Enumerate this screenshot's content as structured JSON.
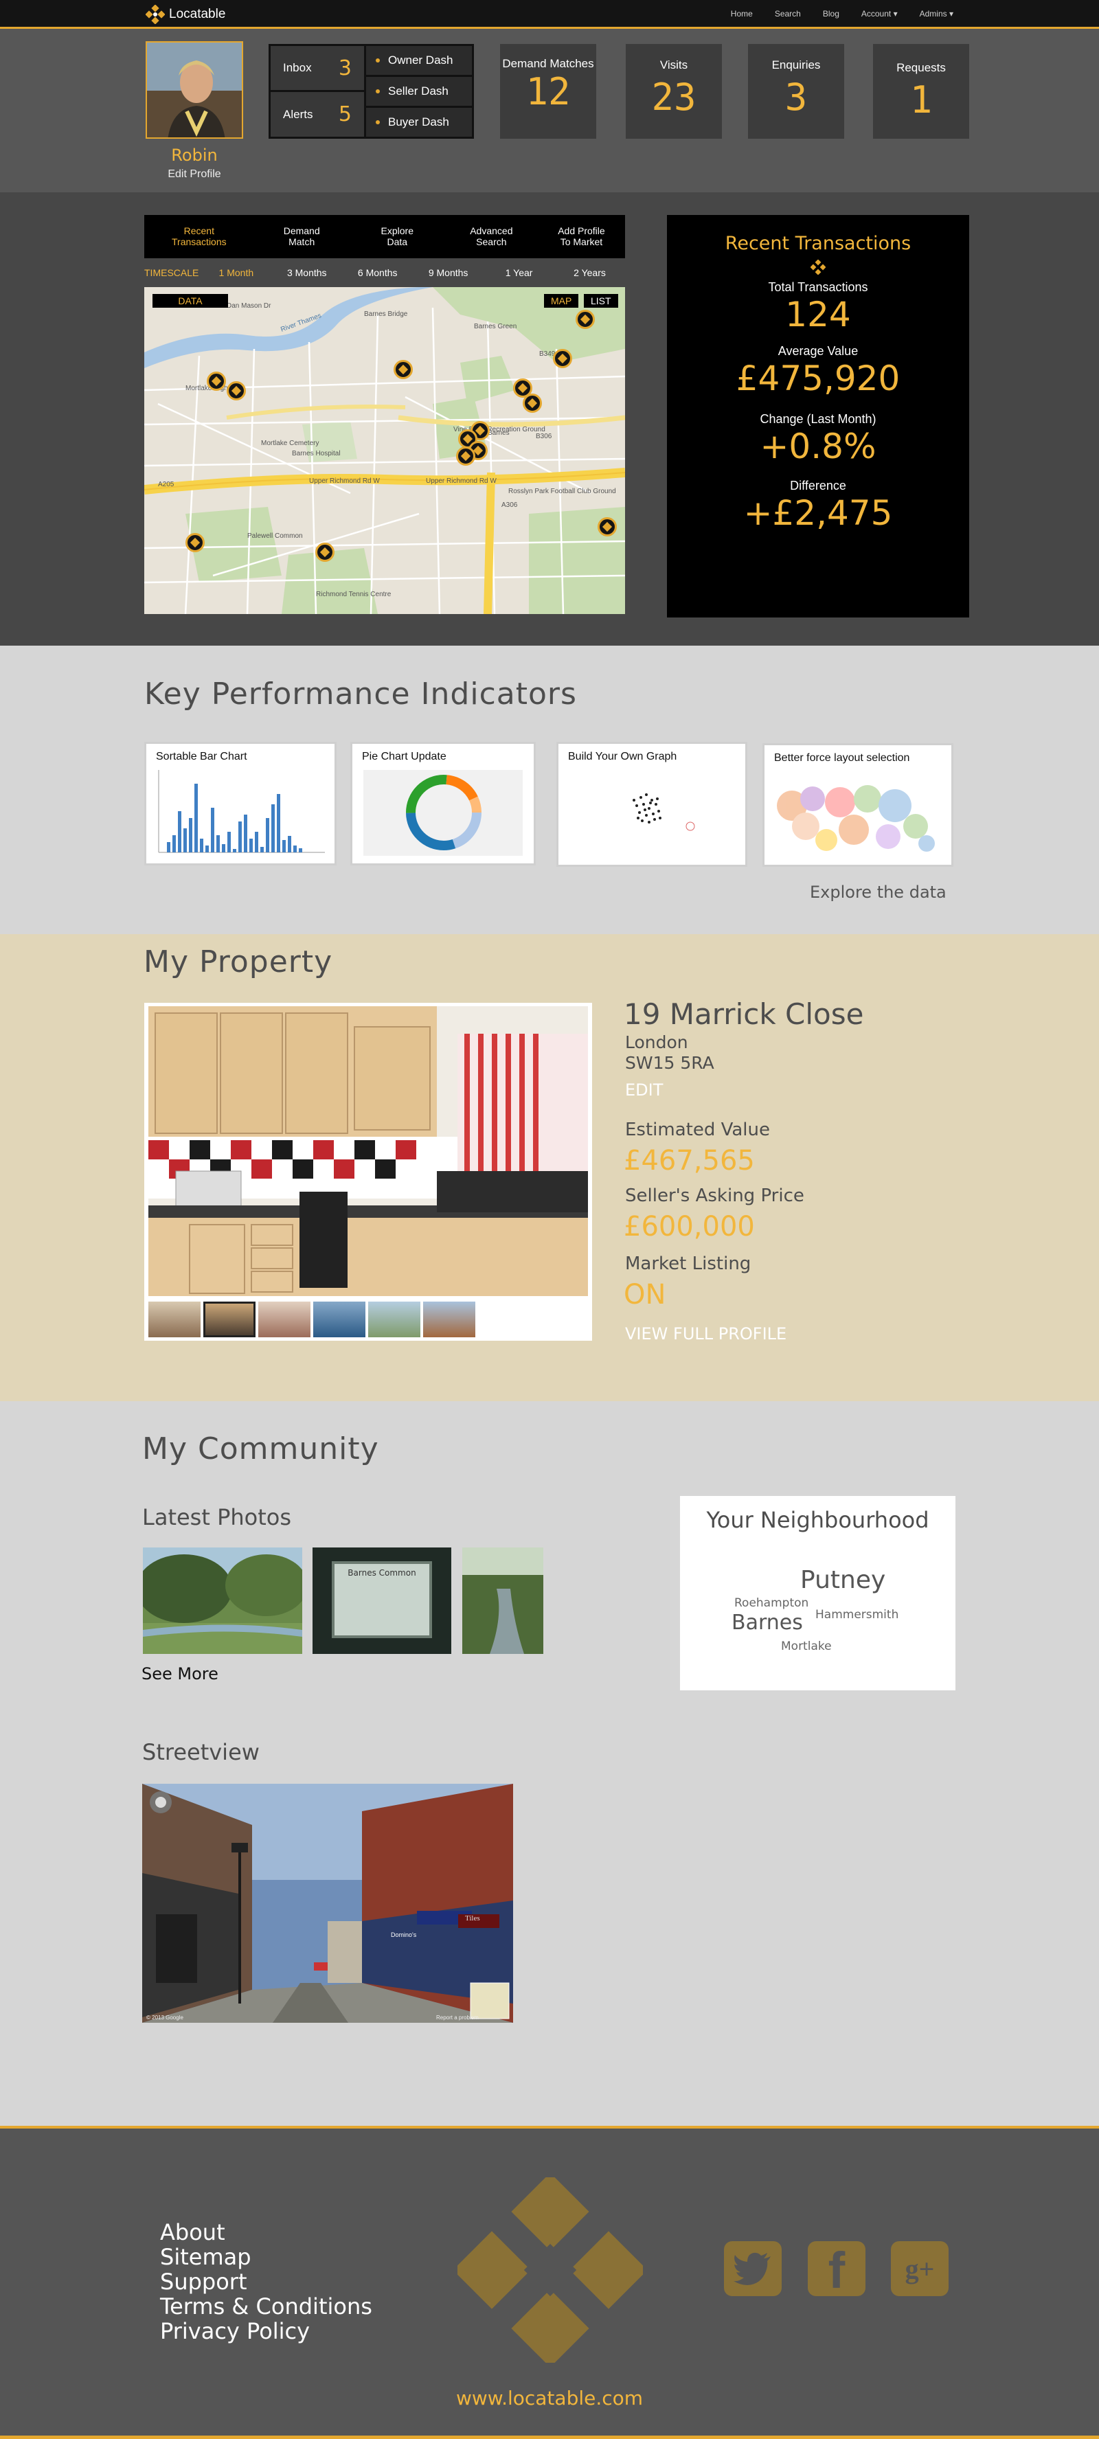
{
  "nav": {
    "brand": "Locatable",
    "links": [
      "Home",
      "Search",
      "Blog",
      "Account",
      "Admins"
    ]
  },
  "profile": {
    "name": "Robin",
    "edit": "Edit Profile"
  },
  "messages": {
    "inbox_label": "Inbox",
    "inbox_count": "3",
    "alerts_label": "Alerts",
    "alerts_count": "5"
  },
  "dash_buttons": [
    "Owner Dash",
    "Seller Dash",
    "Buyer Dash"
  ],
  "stats": [
    {
      "label": "Demand Matches",
      "value": "12"
    },
    {
      "label": "Visits",
      "value": "23"
    },
    {
      "label": "Enquiries",
      "value": "3"
    },
    {
      "label": "Requests",
      "value": "1"
    }
  ],
  "tabs": [
    "Recent Transactions",
    "Demand Match",
    "Explore Data",
    "Advanced Search",
    "Add Profile To Market"
  ],
  "timescale": {
    "label": "TIMESCALE",
    "options": [
      "1 Month",
      "3 Months",
      "6 Months",
      "9 Months",
      "1 Year",
      "2 Years"
    ],
    "selected": "1 Month"
  },
  "map": {
    "data_button": "DATA",
    "map_button": "MAP",
    "list_button": "LIST",
    "labels": {
      "barnes_bridge": "Barnes Bridge",
      "barnes_green": "Barnes Green",
      "mortlake_high_st": "Mortlake High St",
      "vine_road": "Vine Road Recreation Ground",
      "mortlake_cemetery": "Mortlake Cemetery",
      "barnes_hospital": "Barnes Hospital",
      "upper_richmond": "Upper Richmond Rd W",
      "upper_richmond_2": "Upper Richmond Rd W",
      "rosslyn_park": "Rosslyn Park Football Club Ground",
      "barnes": "Barnes",
      "palewell": "Palewell Common",
      "richmond_tennis": "Richmond Tennis Centre",
      "a205": "A205",
      "b349": "B349",
      "a306": "A306",
      "b306": "B306",
      "dan_mason": "Dan Mason Dr",
      "thames": "River Thames"
    }
  },
  "recent_transactions": {
    "title": "Recent Transactions",
    "total_label": "Total Transactions",
    "total_value": "124",
    "avg_label": "Average Value",
    "avg_value": "£475,920",
    "change_label": "Change (Last Month)",
    "change_value": "+0.8%",
    "diff_label": "Difference",
    "diff_value": "+£2,475"
  },
  "kpi": {
    "title": "Key Performance Indicators",
    "cards": [
      "Sortable Bar Chart",
      "Pie Chart Update",
      "Build Your Own Graph",
      "Better force layout selection"
    ],
    "explore": "Explore the data"
  },
  "property": {
    "section_title": "My Property",
    "address": "19 Marrick Close",
    "city": "London",
    "postcode": "SW15 5RA",
    "edit": "EDIT",
    "est_label": "Estimated Value",
    "est_value": "£467,565",
    "ask_label": "Seller's Asking Price",
    "ask_value": "£600,000",
    "listing_label": "Market Listing",
    "listing_value": "ON",
    "view_full": "VIEW FULL PROFILE"
  },
  "community": {
    "title": "My Community",
    "photos_title": "Latest Photos",
    "see_more": "See More",
    "sign_text": "Barnes Common",
    "neighbourhood_title": "Your Neighbourhood",
    "places": [
      "Putney",
      "Roehampton",
      "Hammersmith",
      "Barnes",
      "Mortlake"
    ],
    "streetview_title": "Streetview",
    "shops": [
      "Tiles",
      "Domino's"
    ],
    "copyright": "© 2013 Google",
    "report": "Report a problem"
  },
  "footer": {
    "links": [
      "About",
      "Sitemap",
      "Support",
      "Terms & Conditions",
      "Privacy Policy"
    ],
    "url": "www.locatable.com"
  },
  "colors": {
    "accent": "#f2b63c",
    "dark": "#141414",
    "panel": "#575757"
  }
}
